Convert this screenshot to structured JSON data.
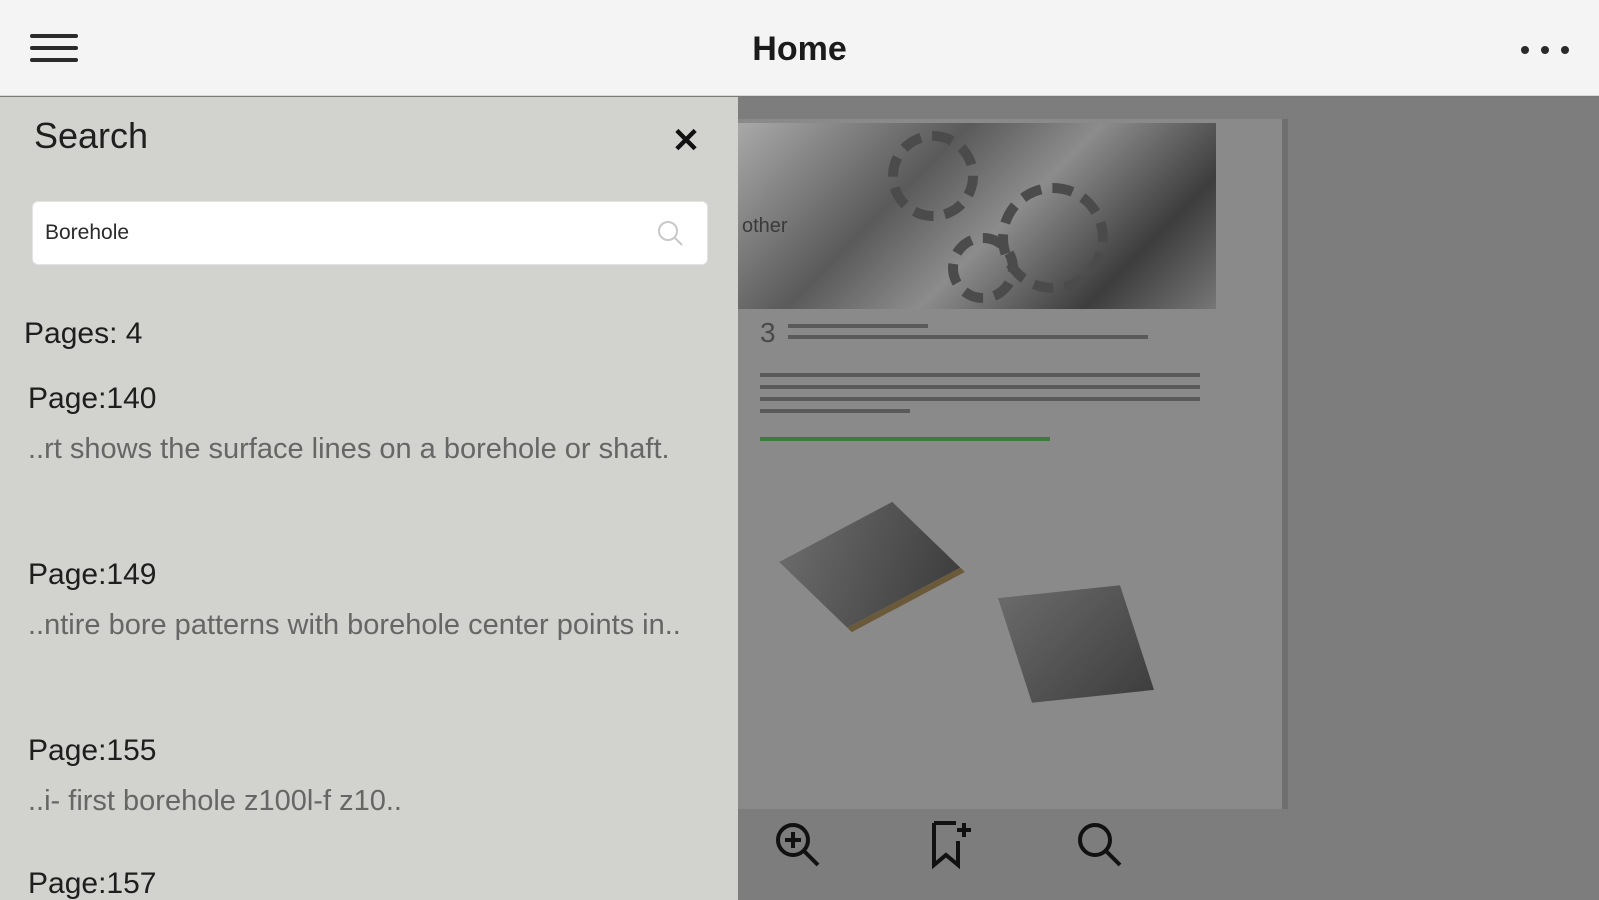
{
  "header": {
    "title": "Home",
    "menu_icon": "hamburger-menu-icon",
    "more_icon": "more-horizontal-icon"
  },
  "search_panel": {
    "title": "Search",
    "close_icon": "close-icon",
    "query": "Borehole",
    "pages_count_label": "Pages: 4",
    "results": [
      {
        "page": "Page:140",
        "snippet": "..rt shows the surface lines on a borehole or shaft."
      },
      {
        "page": "Page:149",
        "snippet": "..ntire bore patterns with borehole center points in.."
      },
      {
        "page": "Page:155",
        "snippet": "..i- first borehole z100l-f z10.."
      },
      {
        "page": "Page:157",
        "snippet": ""
      }
    ]
  },
  "viewer": {
    "page_side_text": "other",
    "step_number": "3",
    "toolbar": {
      "zoom_icon": "zoom-in-icon",
      "bookmark_icon": "bookmark-add-icon",
      "search_icon": "search-icon"
    }
  },
  "colors": {
    "topbar_bg": "#f4f4f5",
    "panel_bg": "#d2d2cf",
    "viewer_bg": "#7d7d7d"
  }
}
